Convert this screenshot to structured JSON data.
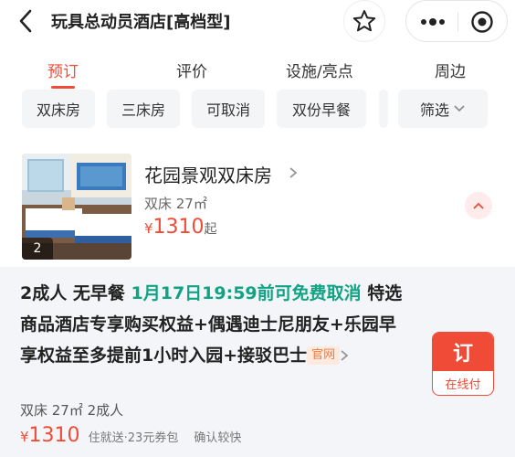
{
  "header": {
    "title": "玩具总动员酒店[高档型]",
    "icons": {
      "back": "back-arrow-icon",
      "favorite": "star-icon",
      "more": "more-dots-icon",
      "close": "target-circle-icon"
    }
  },
  "tabs": [
    {
      "label": "预订",
      "active": true
    },
    {
      "label": "评价",
      "active": false
    },
    {
      "label": "设施/亮点",
      "active": false
    },
    {
      "label": "周边",
      "active": false
    }
  ],
  "filters": {
    "chips": [
      "双床房",
      "三床房",
      "可取消",
      "双份早餐"
    ],
    "filter_label": "筛选"
  },
  "room": {
    "name": "花园景观双床房",
    "meta": "双床 27㎡",
    "currency": "¥",
    "price": "1310",
    "price_suffix": "起",
    "photo_count": "2"
  },
  "rate_plan": {
    "guests": "2成人",
    "breakfast": "无早餐",
    "cancel_policy": "1月17日19:59前可免费取消",
    "benefits": "特选商品酒店专享购买权益+偶遇迪士尼朋友+乐园早享权益至多提前1小时入园+接驳巴士",
    "official_badge": "官网",
    "beds_info": "双床 27㎡ 2成人",
    "currency": "¥",
    "price": "1310",
    "coupon_note": "住就送·23元券包",
    "confirm_note": "确认较快",
    "book_label": "订",
    "pay_label": "在线付"
  },
  "colors": {
    "accent": "#f04b36",
    "cancel_green": "#11a383",
    "badge_orange": "#f07a3a",
    "rate_bg": "#f3f5f8"
  }
}
